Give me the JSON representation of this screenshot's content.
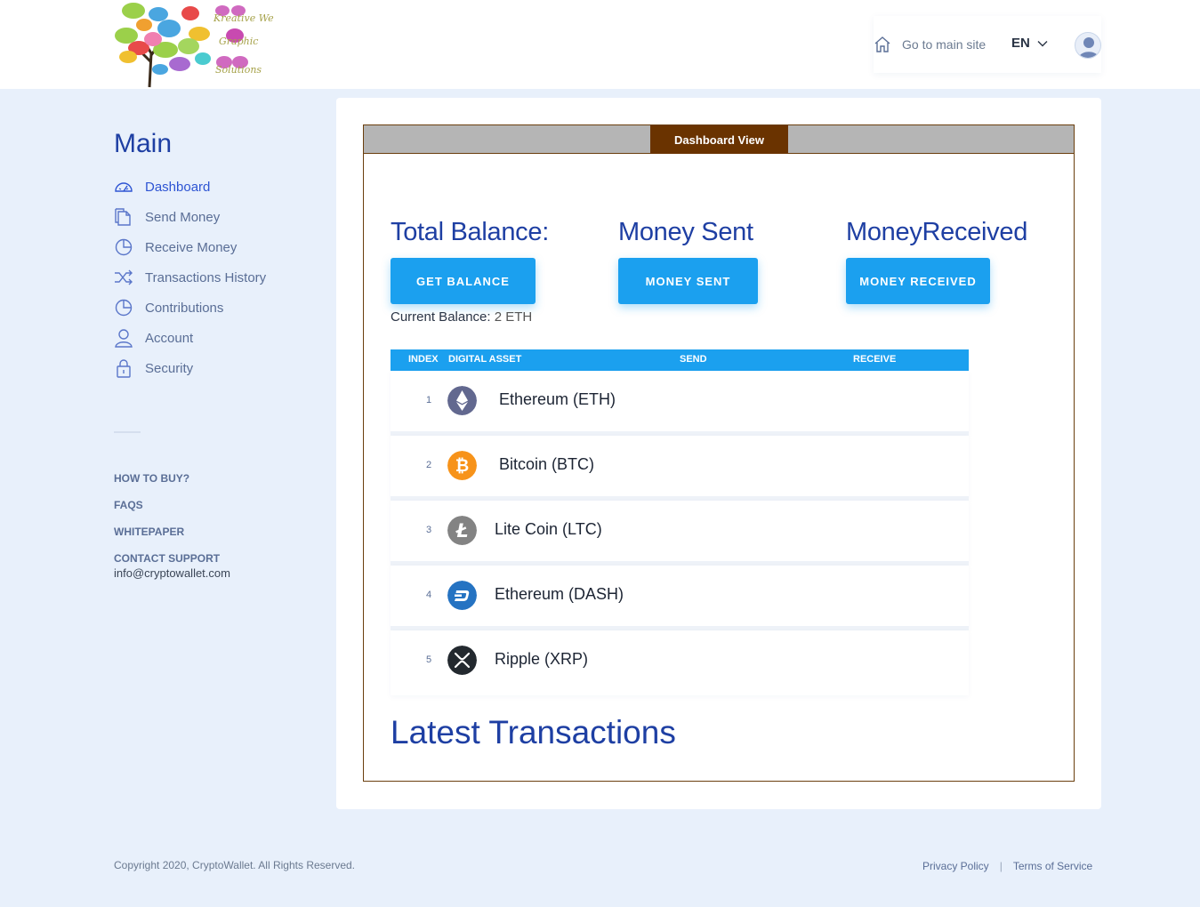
{
  "header": {
    "logo_text_lines": [
      "Kreative Web",
      "Graphic",
      "Solutions"
    ],
    "main_site_label": "Go to main site",
    "language": "EN"
  },
  "sidebar": {
    "title": "Main",
    "items": [
      {
        "label": "Dashboard",
        "icon": "dashboard-icon",
        "active": true
      },
      {
        "label": "Send Money",
        "icon": "document-icon"
      },
      {
        "label": "Receive Money",
        "icon": "pie-chart-icon"
      },
      {
        "label": "Transactions History",
        "icon": "shuffle-icon"
      },
      {
        "label": "Contributions",
        "icon": "pie-chart-icon"
      },
      {
        "label": "Account",
        "icon": "user-icon"
      },
      {
        "label": "Security",
        "icon": "lock-icon"
      }
    ],
    "links": [
      "HOW TO BUY?",
      "FAQS",
      "WHITEPAPER",
      "CONTACT SUPPORT"
    ],
    "support_email": "info@cryptowallet.com"
  },
  "panel": {
    "tab_label": "Dashboard View",
    "stats": [
      {
        "heading": "Total Balance:",
        "button": "GET BALANCE"
      },
      {
        "heading": "Money Sent",
        "button": "MONEY SENT"
      },
      {
        "heading": "MoneyReceived",
        "button": "MONEY RECEIVED"
      }
    ],
    "current_balance_label": "Current Balance:",
    "current_balance_value": "2 ETH",
    "table": {
      "headers": [
        "INDEX",
        "DIGITAL ASSET",
        "SEND",
        "RECEIVE"
      ],
      "rows": [
        {
          "index": "1",
          "name": "Ethereum (ETH)",
          "icon": "ethereum-icon",
          "color": "#62688f"
        },
        {
          "index": "2",
          "name": "Bitcoin (BTC)",
          "icon": "bitcoin-icon",
          "color": "#f7931a"
        },
        {
          "index": "3",
          "name": "Lite Coin (LTC)",
          "icon": "litecoin-icon",
          "color": "#838383"
        },
        {
          "index": "4",
          "name": "Ethereum (DASH)",
          "icon": "dash-icon",
          "color": "#2573c2"
        },
        {
          "index": "5",
          "name": "Ripple (XRP)",
          "icon": "ripple-icon",
          "color": "#23292f"
        }
      ]
    },
    "latest_title": "Latest Transactions"
  },
  "footer": {
    "copyright": "Copyright 2020, CryptoWallet. All Rights Reserved.",
    "privacy": "Privacy Policy",
    "separator": "|",
    "terms": "Terms of Service"
  },
  "colors": {
    "accent": "#1ba0ef",
    "heading": "#1e3fa3",
    "tab": "#6a3300"
  }
}
